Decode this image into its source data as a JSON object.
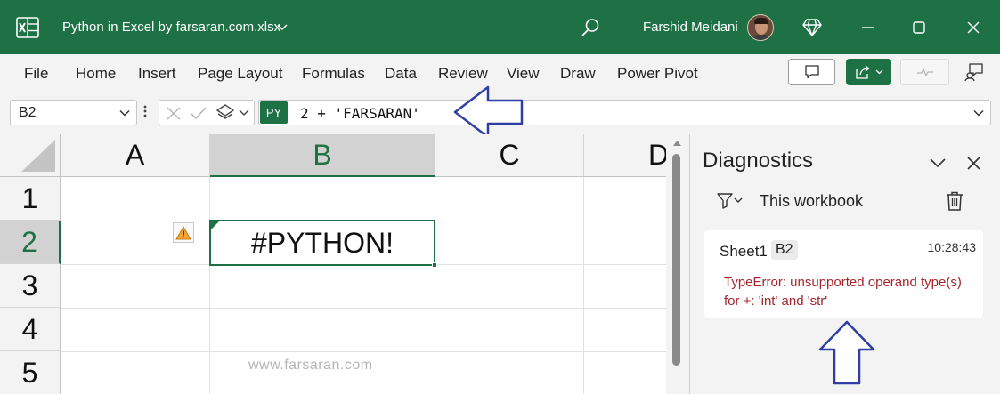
{
  "window": {
    "filename": "Python in Excel by farsaran.com.xlsx",
    "user": "Farshid Meidani"
  },
  "menu": {
    "items": [
      "File",
      "Home",
      "Insert",
      "Page Layout",
      "Formulas",
      "Data",
      "Review",
      "View",
      "Draw",
      "Power Pivot"
    ]
  },
  "formula_bar": {
    "name_box": "B2",
    "py_badge": "PY",
    "formula": "2 + 'FARSARAN'"
  },
  "grid": {
    "columns": [
      "A",
      "B",
      "C",
      "D"
    ],
    "selected_column": "B",
    "rows": [
      "1",
      "2",
      "3",
      "4",
      "5"
    ],
    "selected_row": "2",
    "cell_b2_value": "#PYTHON!",
    "watermark": "www.farsaran.com"
  },
  "diagnostics": {
    "title": "Diagnostics",
    "scope": "This workbook",
    "entry": {
      "sheet": "Sheet1",
      "cell": "B2",
      "time": "10:28:43",
      "error": "TypeError: unsupported operand type(s) for +: 'int' and 'str'"
    }
  },
  "colors": {
    "accent": "#1e7145",
    "error_text": "#a4262c",
    "annotation_arrow": "#2e3fa3"
  },
  "icons": [
    "excel-logo-icon",
    "chevron-down-icon",
    "search-icon",
    "diamond-icon",
    "minimize-icon",
    "maximize-icon",
    "close-icon",
    "comment-icon",
    "share-icon",
    "activity-icon",
    "feedback-icon",
    "cancel-x-icon",
    "check-icon",
    "layers-icon",
    "more-dots-icon",
    "warning-icon",
    "filter-icon",
    "trash-icon",
    "arrow-left-annotation",
    "arrow-up-annotation"
  ]
}
